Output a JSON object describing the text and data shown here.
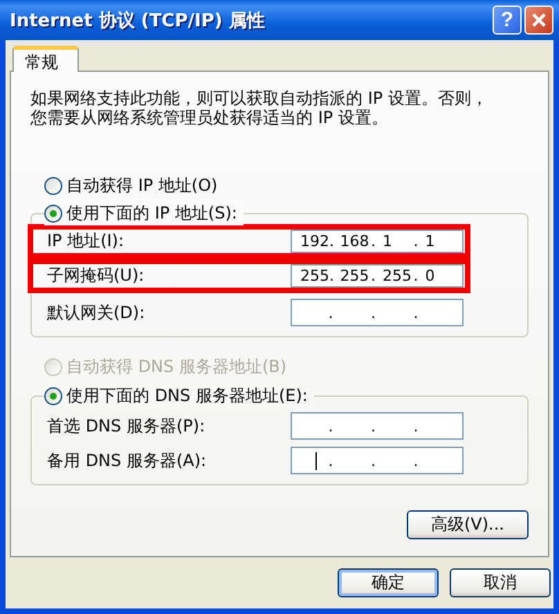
{
  "window": {
    "title": "Internet 协议 (TCP/IP) 属性",
    "help_button": "?"
  },
  "tabs": [
    {
      "label": "常规",
      "selected": true
    }
  ],
  "description": [
    "如果网络支持此功能，则可以获取自动指派的 IP 设置。否则，",
    "您需要从网络系统管理员处获得适当的 IP 设置。"
  ],
  "octet_separator": ".",
  "ip_section": {
    "radios": [
      {
        "label": "自动获得 IP 地址(O)",
        "selected": false,
        "disabled": false
      },
      {
        "label": "使用下面的 IP 地址(S):",
        "selected": true,
        "disabled": false
      }
    ],
    "fields": [
      {
        "label": "IP 地址(I):",
        "octets": [
          "192",
          "168",
          "1",
          "1"
        ],
        "highlighted": true,
        "focused": false
      },
      {
        "label": "子网掩码(U):",
        "octets": [
          "255",
          "255",
          "255",
          "0"
        ],
        "highlighted": true,
        "focused": false
      },
      {
        "label": "默认网关(D):",
        "highlighted": false,
        "focused": false
      }
    ]
  },
  "dns_section": {
    "radios": [
      {
        "label": "自动获得 DNS 服务器地址(B)",
        "selected": false,
        "disabled": true
      },
      {
        "label": "使用下面的 DNS 服务器地址(E):",
        "selected": true,
        "disabled": false
      }
    ],
    "fields": [
      {
        "label": "首选 DNS 服务器(P):",
        "highlighted": false,
        "focused": false
      },
      {
        "label": "备用 DNS 服务器(A):",
        "highlighted": false,
        "focused": true
      }
    ]
  },
  "advanced_button": "高级(V)...",
  "buttons": [
    {
      "label": "确定",
      "default": true
    },
    {
      "label": "取消",
      "default": false
    }
  ]
}
